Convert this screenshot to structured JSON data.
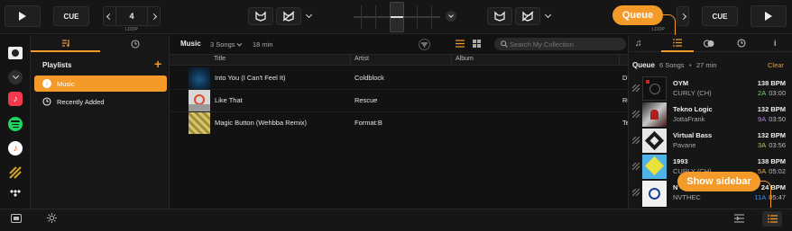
{
  "top_bar": {
    "left_deck": {
      "cue_label": "CUE",
      "loop_value": "4",
      "loop_label": "LOOP"
    },
    "right_deck": {
      "cue_label": "CUE",
      "loop_label": "LOOP"
    }
  },
  "tooltips": {
    "queue": "Queue",
    "show_sidebar": "Show sidebar"
  },
  "sidebar": {
    "title": "Playlists",
    "add_label": "+",
    "items": [
      {
        "label": "Music",
        "selected": true
      },
      {
        "label": "Recently Added",
        "selected": false
      }
    ]
  },
  "browser": {
    "title": "Music",
    "song_count": "3 Songs",
    "duration": "18 min",
    "search_placeholder": "Search My Collection",
    "columns": [
      "Title",
      "Artist",
      "Album"
    ],
    "rows": [
      {
        "title": "Into You (I Can't Feel It)",
        "artist": "Coldblock",
        "album": "",
        "trail": "D"
      },
      {
        "title": "Like That",
        "artist": "Rescue",
        "album": "",
        "trail": "Re"
      },
      {
        "title": "Magic Button (Wehbba Remix)",
        "artist": "Format:B",
        "album": "",
        "trail": "Te"
      }
    ]
  },
  "queue": {
    "title": "Queue",
    "song_count": "6 Songs",
    "duration": "27 min",
    "clear_label": "Clear",
    "items": [
      {
        "title": "OYM",
        "artist": "CURLY (CH)",
        "bpm": "138 BPM",
        "key": "2A",
        "time": "03:00",
        "key_color": "#6fd36a"
      },
      {
        "title": "Tekno Logic",
        "artist": "JottaFrank",
        "bpm": "132 BPM",
        "key": "9A",
        "time": "03:50",
        "key_color": "#b27cf0"
      },
      {
        "title": "Virtual Bass",
        "artist": "Pavane",
        "bpm": "132 BPM",
        "key": "3A",
        "time": "03:56",
        "key_color": "#a6d84f"
      },
      {
        "title": "1993",
        "artist": "CURLY (CH)",
        "bpm": "138 BPM",
        "key": "5A",
        "time": "05:02",
        "key_color": "#f0a43a"
      },
      {
        "title": "N",
        "artist": "NVTHEC",
        "bpm": "24 BPM",
        "key": "11A",
        "time": "05:47",
        "key_color": "#3b8ff0"
      }
    ]
  },
  "colors": {
    "accent": "#f39a29",
    "background": "#121212",
    "panel": "#171717"
  }
}
